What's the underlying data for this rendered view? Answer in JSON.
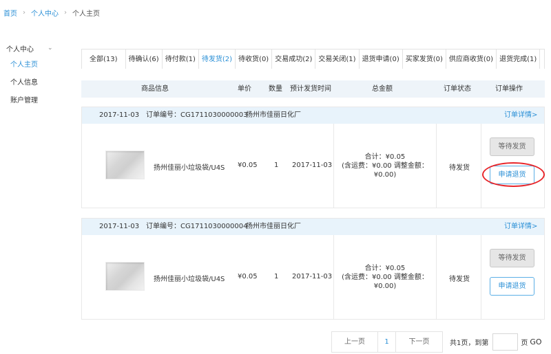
{
  "breadcrumb": {
    "home": "首页",
    "center": "个人中心",
    "current": "个人主页",
    "sep": "›"
  },
  "sidebar": {
    "title": "个人中心",
    "chevron": "⌄",
    "items": [
      "个人主页",
      "个人信息",
      "账户管理"
    ]
  },
  "tabs": [
    "全部(13)",
    "待确认(6)",
    "待付款(1)",
    "待发货(2)",
    "待收货(0)",
    "交易成功(2)",
    "交易关闭(1)",
    "退货申请(0)",
    "买家发货(0)",
    "供应商收货(0)",
    "退货完成(1)"
  ],
  "table_header": {
    "product": "商品信息",
    "price": "单价",
    "qty": "数量",
    "ship_time": "预计发货时间",
    "total": "总金额",
    "status": "订单状态",
    "action": "订单操作"
  },
  "orders": [
    {
      "date": "2017-11-03",
      "order_no": "订单编号：CG1711030000003",
      "supplier": "扬州市佳丽日化厂",
      "detail": "订单详情>",
      "product_name": "扬州佳丽小垃圾袋/U4S",
      "price": "¥0.05",
      "qty": "1",
      "ship_date": "2017-11-03",
      "total_line1": "合计：¥0.05",
      "total_line2": "(含运费：¥0.00 调整金额：",
      "total_line3": "¥0.00)",
      "status": "待发货",
      "btn_wait": "等待发货",
      "btn_refund": "申请退货"
    },
    {
      "date": "2017-11-03",
      "order_no": "订单编号：CG1711030000004",
      "supplier": "扬州市佳丽日化厂",
      "detail": "订单详情>",
      "product_name": "扬州佳丽小垃圾袋/U4S",
      "price": "¥0.05",
      "qty": "1",
      "ship_date": "2017-11-03",
      "total_line1": "合计：¥0.05",
      "total_line2": "(含运费：¥0.00 调整金额：",
      "total_line3": "¥0.00)",
      "status": "待发货",
      "btn_wait": "等待发货",
      "btn_refund": "申请退货"
    }
  ],
  "pager": {
    "prev": "上一页",
    "current": "1",
    "next": "下一页",
    "info": "共1页，到第",
    "unit": "页",
    "go": "GO"
  },
  "colors": {
    "accent": "#2a8fd6",
    "annotation": "#e8262a",
    "header_bg": "#eef4f9"
  }
}
